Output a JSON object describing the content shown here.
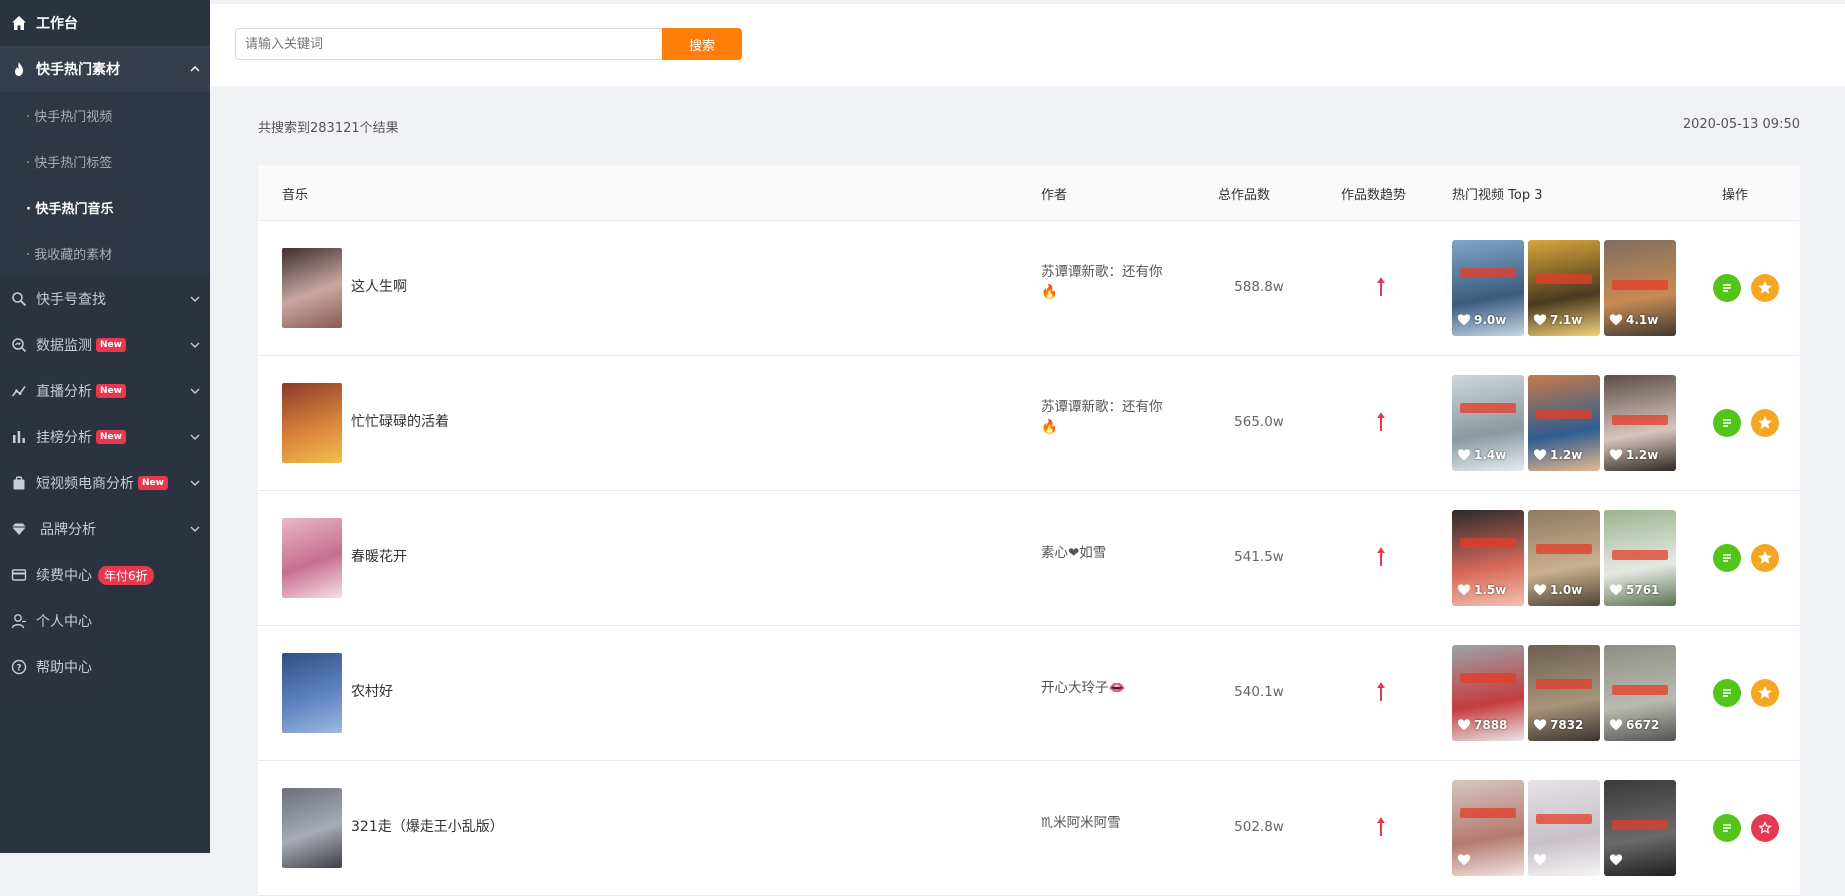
{
  "sidebar": {
    "workbench": "工作台",
    "hot_material": "快手热门素材",
    "sub_items": [
      "· 快手热门视频",
      "· 快手热门标签",
      "· 快手热门音乐",
      "· 我收藏的素材"
    ],
    "account_search": "快手号查找",
    "data_monitor": "数据监测",
    "live_analysis": "直播分析",
    "rank_analysis": "挂榜分析",
    "ecommerce_analysis": "短视频电商分析",
    "brand_analysis": "品牌分析",
    "renew_center": "续费中心",
    "renew_promo": "年付6折",
    "personal_center": "个人中心",
    "help_center": "帮助中心",
    "new_badge": "New"
  },
  "search": {
    "placeholder": "请输入关键词",
    "button": "搜索"
  },
  "summary": "共搜索到283121个结果",
  "timestamp": "2020-05-13 09:50",
  "table": {
    "headers": {
      "music": "音乐",
      "author": "作者",
      "total": "总作品数",
      "trend": "作品数趋势",
      "top3": "热门视频 Top 3",
      "ops": "操作"
    },
    "rows": [
      {
        "song": "这人生啊",
        "author_line1": "苏谭谭新歌：还有你",
        "author_line2": "🔥",
        "total": "588.8w",
        "likes": [
          "9.0w",
          "7.1w",
          "4.1w"
        ],
        "favorited": false
      },
      {
        "song": "忙忙碌碌的活着",
        "author_line1": "苏谭谭新歌：还有你",
        "author_line2": "🔥",
        "total": "565.0w",
        "likes": [
          "1.4w",
          "1.2w",
          "1.2w"
        ],
        "favorited": false
      },
      {
        "song": "春暖花开",
        "author_line1": "素心❤如雪",
        "author_line2": "",
        "total": "541.5w",
        "likes": [
          "1.5w",
          "1.0w",
          "5761"
        ],
        "favorited": false
      },
      {
        "song": "农村好",
        "author_line1": "开心大玲子👄",
        "author_line2": "",
        "total": "540.1w",
        "likes": [
          "7888",
          "7832",
          "6672"
        ],
        "favorited": false
      },
      {
        "song": "321走（爆走王小乱版）",
        "author_line1": "♏米阿米阿雪",
        "author_line2": "",
        "total": "502.8w",
        "likes": [
          "",
          "",
          ""
        ],
        "favorited": true
      }
    ]
  },
  "colors": {
    "sidebar_bg": "#2b3240",
    "accent_orange": "#ff7d0b",
    "detail_green": "#52c41a",
    "fav_orange": "#f5a623",
    "fav_red": "#e8384f",
    "trend_red": "#e8384f"
  }
}
